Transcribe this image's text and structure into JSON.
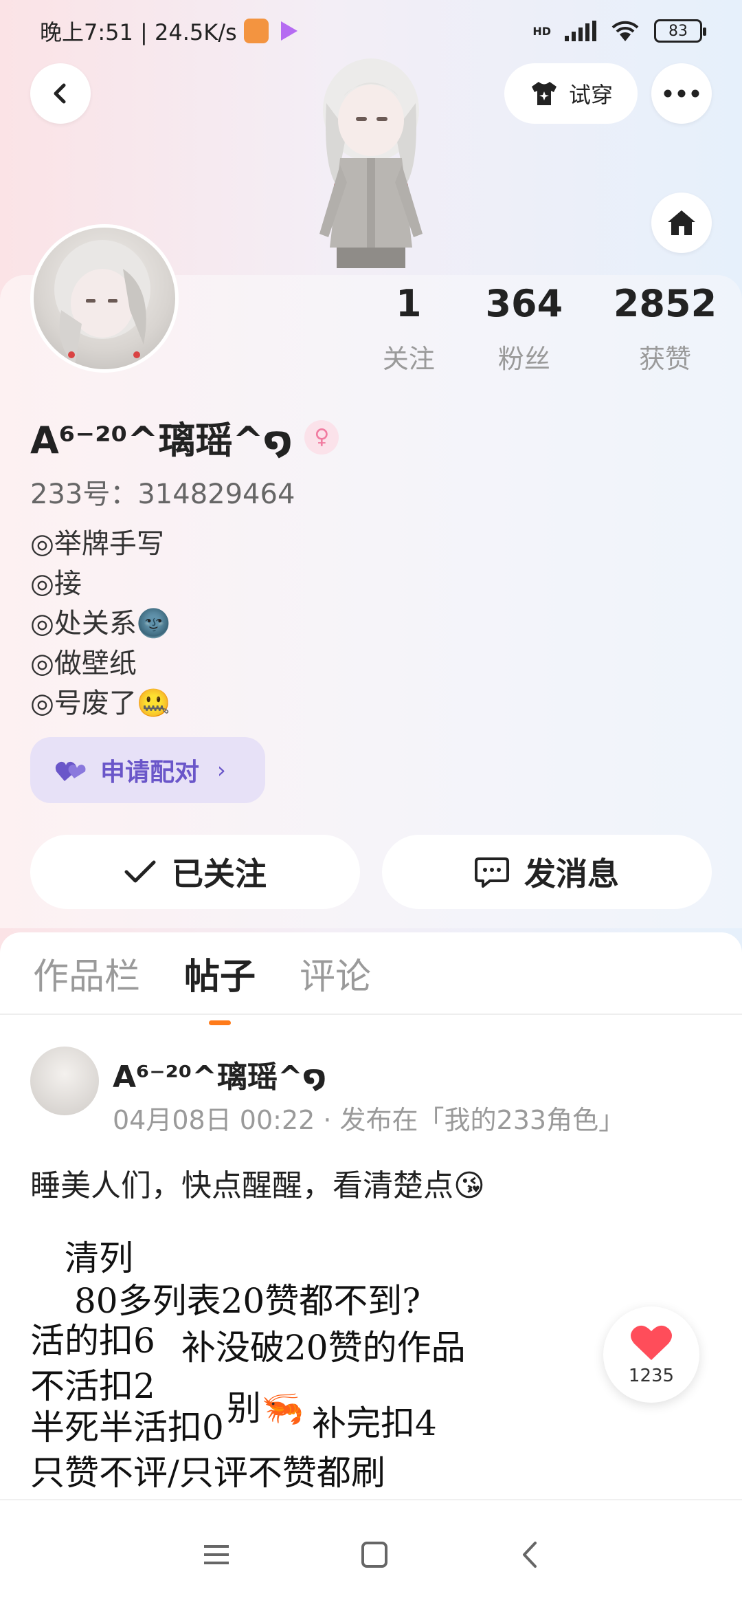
{
  "status_bar": {
    "time_speed": "晚上7:51 | 24.5K/s",
    "network": "HD",
    "battery": "83"
  },
  "header": {
    "try_on_label": "试穿"
  },
  "profile": {
    "stats": [
      {
        "value": "1",
        "label": "关注"
      },
      {
        "value": "364",
        "label": "粉丝"
      },
      {
        "value": "2852",
        "label": "获赞"
      }
    ],
    "name": "A⁶⁻²⁰^璃瑶^໑",
    "uid": "233号：314829464",
    "bio": [
      "◎举牌手写",
      "◎接",
      "◎处关系🌚",
      "◎做壁纸",
      "◎号废了🤐"
    ],
    "pair_button": "申请配对",
    "follow_button": "已关注",
    "message_button": "发消息"
  },
  "tabs": [
    {
      "label": "作品栏",
      "active": false
    },
    {
      "label": "帖子",
      "active": true
    },
    {
      "label": "评论",
      "active": false
    }
  ],
  "post": {
    "author": "A⁶⁻²⁰^璃瑶^໑",
    "meta": "04月08日 00:22 · 发布在「我的233角色」",
    "text": "睡美人们，快点醒醒，看清楚点😘",
    "image_lines": [
      "清列",
      "80多列表20赞都不到?",
      "活的扣6",
      "补没破20赞的作品",
      "不活扣2",
      "半死半活扣0",
      "别🦐",
      "补完扣4",
      "只赞不评/只评不赞都刷"
    ]
  },
  "like": {
    "count": "1235"
  },
  "colors": {
    "accent": "#ff7b1a",
    "pair": "#6a56c9",
    "like": "#ff4d5a"
  }
}
